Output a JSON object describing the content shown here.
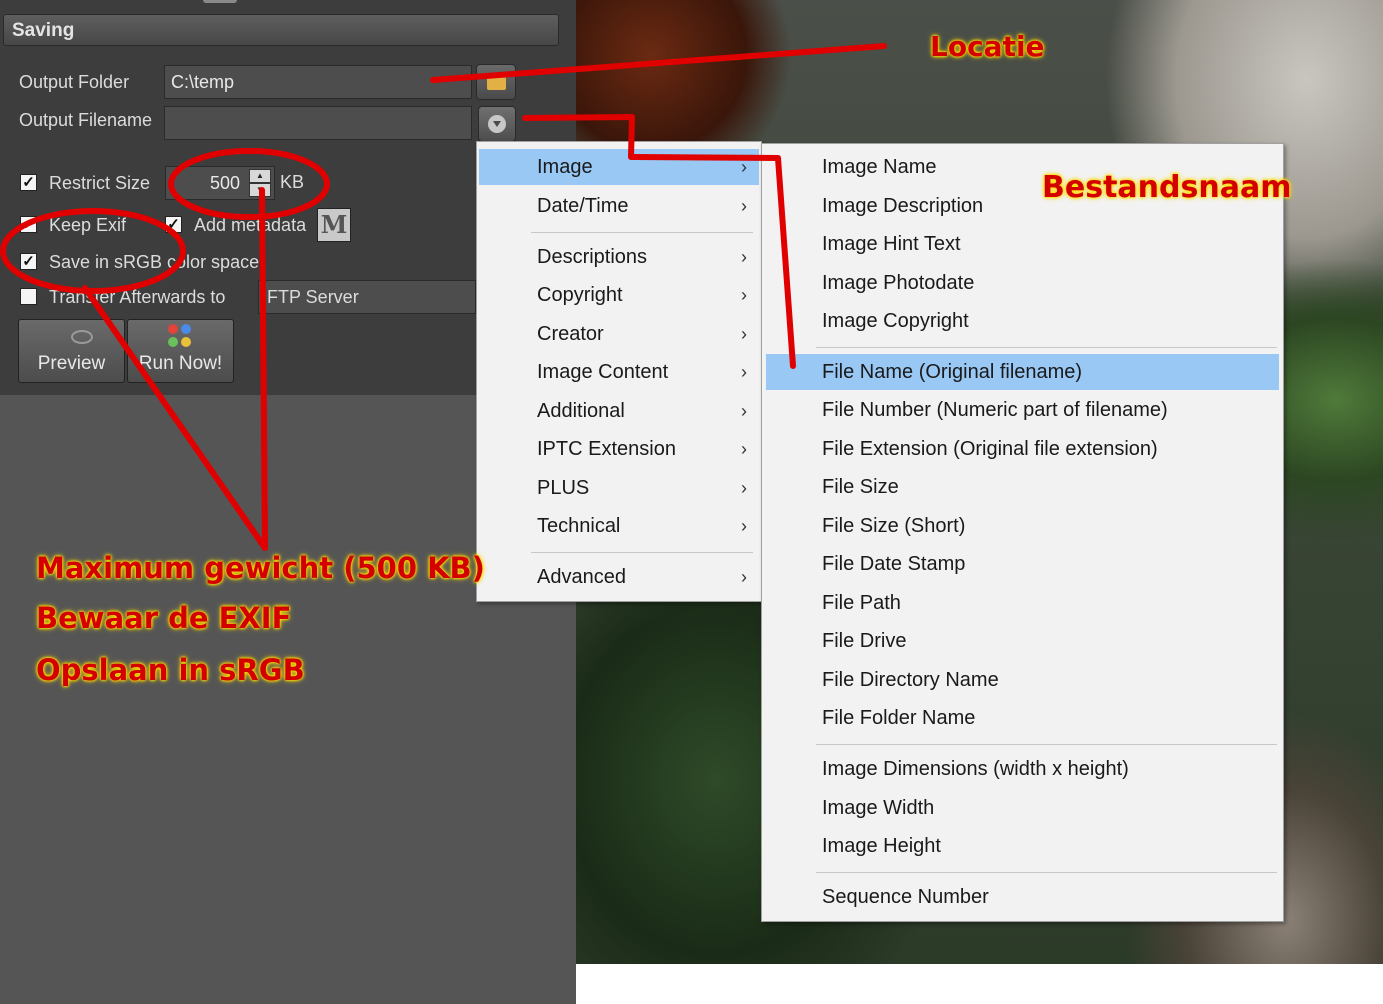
{
  "panel": {
    "section_title": "Saving",
    "output_folder_label": "Output Folder",
    "output_folder_value": "C:\\temp",
    "output_filename_label": "Output Filename",
    "output_filename_value": "",
    "restrict_size_label": "Restrict Size",
    "restrict_size_checked": true,
    "size_value": "500",
    "size_unit": "KB",
    "keep_exif_label": "Keep Exif",
    "keep_exif_checked": true,
    "add_metadata_label": "Add metadata",
    "add_metadata_checked": true,
    "metadata_button_label": "M",
    "srgb_label": "Save in sRGB color space",
    "srgb_checked": true,
    "transfer_label": "Transfer Afterwards to",
    "transfer_checked": false,
    "ftp_value": "FTP Server",
    "preview_label": "Preview",
    "run_label": "Run Now!"
  },
  "menu": {
    "items": [
      {
        "label": "Image",
        "highlighted": true
      },
      {
        "label": "Date/Time"
      },
      {
        "label": "Descriptions"
      },
      {
        "label": "Copyright"
      },
      {
        "label": "Creator"
      },
      {
        "label": "Image Content"
      },
      {
        "label": "Additional"
      },
      {
        "label": "IPTC Extension"
      },
      {
        "label": "PLUS"
      },
      {
        "label": "Technical"
      },
      {
        "label": "Advanced"
      }
    ],
    "arrow_glyph": "›"
  },
  "submenu": {
    "items": [
      {
        "label": "Image Name"
      },
      {
        "label": "Image Description"
      },
      {
        "label": "Image Hint Text"
      },
      {
        "label": "Image Photodate"
      },
      {
        "label": "Image Copyright"
      },
      {
        "label": "File Name (Original filename)",
        "highlighted": true
      },
      {
        "label": "File Number (Numeric part of filename)"
      },
      {
        "label": "File Extension (Original file extension)"
      },
      {
        "label": "File Size"
      },
      {
        "label": "File Size (Short)"
      },
      {
        "label": "File Date Stamp"
      },
      {
        "label": "File Path"
      },
      {
        "label": "File Drive"
      },
      {
        "label": "File Directory Name"
      },
      {
        "label": "File Folder Name"
      },
      {
        "label": "Image Dimensions (width x height)"
      },
      {
        "label": "Image Width"
      },
      {
        "label": "Image Height"
      },
      {
        "label": "Sequence Number"
      }
    ]
  },
  "annotations": {
    "locatie": "Locatie",
    "bestandsnaam": "Bestandsnaam",
    "max_weight": "Maximum gewicht (500 KB)",
    "keep_exif": "Bewaar de EXIF",
    "srgb": "Opslaan in sRGB",
    "color": "#d40000",
    "glow_color": "#ffe600"
  },
  "colors": {
    "menu_highlight": "#99c8f4",
    "panel_bg": "#3d3d3d",
    "panel_lower_bg": "#555555"
  },
  "icons": {
    "folder_button": "folder-icon",
    "filename_button": "dropdown-circle-icon",
    "preview": "eye-icon",
    "run": "run-dots-icon",
    "checkbox": "checkmark-icon"
  }
}
